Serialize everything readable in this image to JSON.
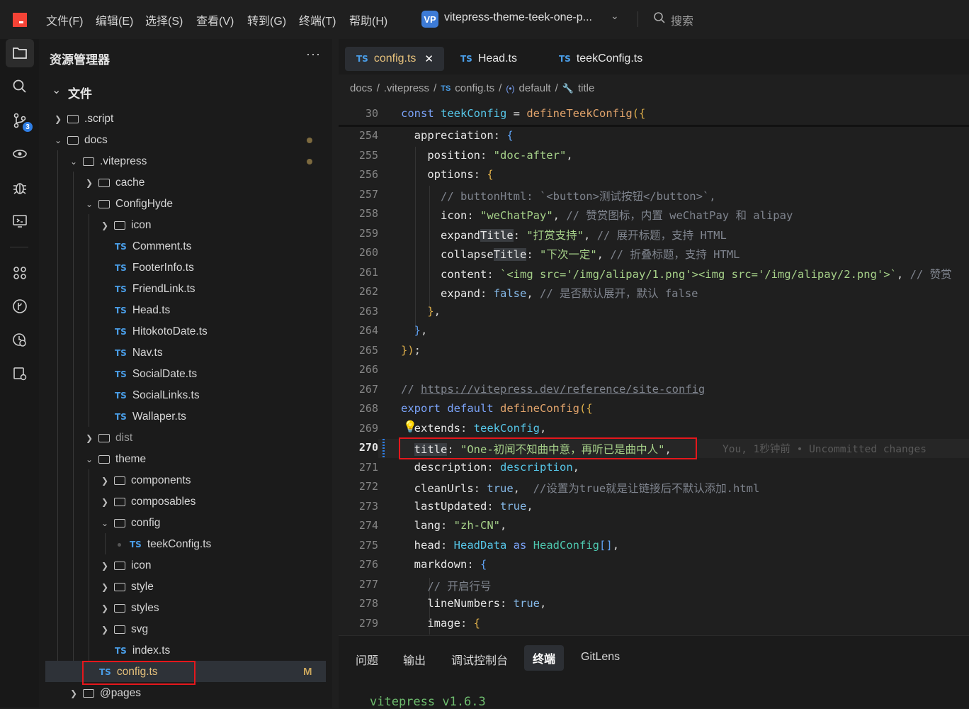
{
  "menu": [
    "文件(F)",
    "编辑(E)",
    "选择(S)",
    "查看(V)",
    "转到(G)",
    "终端(T)",
    "帮助(H)"
  ],
  "project": {
    "badge": "VP",
    "name": "vitepress-theme-teek-one-p..."
  },
  "search": {
    "label": "搜索"
  },
  "activity": {
    "scm_badge": "3"
  },
  "explorer": {
    "title": "资源管理器",
    "section": "文件",
    "modified_marker": "M",
    "items": [
      {
        "name": ".script",
        "type": "folder",
        "open": false
      },
      {
        "name": "docs",
        "type": "folder",
        "open": true
      },
      {
        "name": ".vitepress",
        "type": "folder",
        "open": true
      },
      {
        "name": "cache",
        "type": "folder",
        "open": false
      },
      {
        "name": "ConfigHyde",
        "type": "folder",
        "open": true
      },
      {
        "name": "icon",
        "type": "folder",
        "open": false
      },
      {
        "name": "Comment.ts",
        "type": "ts"
      },
      {
        "name": "FooterInfo.ts",
        "type": "ts"
      },
      {
        "name": "FriendLink.ts",
        "type": "ts"
      },
      {
        "name": "Head.ts",
        "type": "ts"
      },
      {
        "name": "HitokotoDate.ts",
        "type": "ts"
      },
      {
        "name": "Nav.ts",
        "type": "ts"
      },
      {
        "name": "SocialDate.ts",
        "type": "ts"
      },
      {
        "name": "SocialLinks.ts",
        "type": "ts"
      },
      {
        "name": "Wallaper.ts",
        "type": "ts"
      },
      {
        "name": "dist",
        "type": "folder",
        "open": false
      },
      {
        "name": "theme",
        "type": "folder",
        "open": true
      },
      {
        "name": "components",
        "type": "folder",
        "open": false
      },
      {
        "name": "composables",
        "type": "folder",
        "open": false
      },
      {
        "name": "config",
        "type": "folder",
        "open": true
      },
      {
        "name": "teekConfig.ts",
        "type": "ts"
      },
      {
        "name": "icon",
        "type": "folder",
        "open": false
      },
      {
        "name": "style",
        "type": "folder",
        "open": false
      },
      {
        "name": "styles",
        "type": "folder",
        "open": false
      },
      {
        "name": "svg",
        "type": "folder",
        "open": false
      },
      {
        "name": "index.ts",
        "type": "ts"
      },
      {
        "name": "config.ts",
        "type": "ts"
      },
      {
        "name": "@pages",
        "type": "folder",
        "open": false
      }
    ]
  },
  "tabs": [
    {
      "label": "config.ts",
      "close": "✕"
    },
    {
      "label": "Head.ts"
    },
    {
      "label": "teekConfig.ts"
    }
  ],
  "breadcrumb": [
    "docs",
    ".vitepress",
    "config.ts",
    "default",
    "title"
  ],
  "lines": [
    "30",
    "254",
    "255",
    "256",
    "257",
    "258",
    "259",
    "260",
    "261",
    "262",
    "263",
    "264",
    "265",
    "266",
    "267",
    "268",
    "269",
    "270",
    "271",
    "272",
    "273",
    "274",
    "275",
    "276",
    "277",
    "278",
    "279"
  ],
  "blame": "You, 1秒钟前 • Uncommitted changes",
  "panel": {
    "tabs": [
      "问题",
      "输出",
      "调试控制台",
      "终端",
      "GitLens"
    ],
    "terminal": "vitepress v1.6.3"
  }
}
